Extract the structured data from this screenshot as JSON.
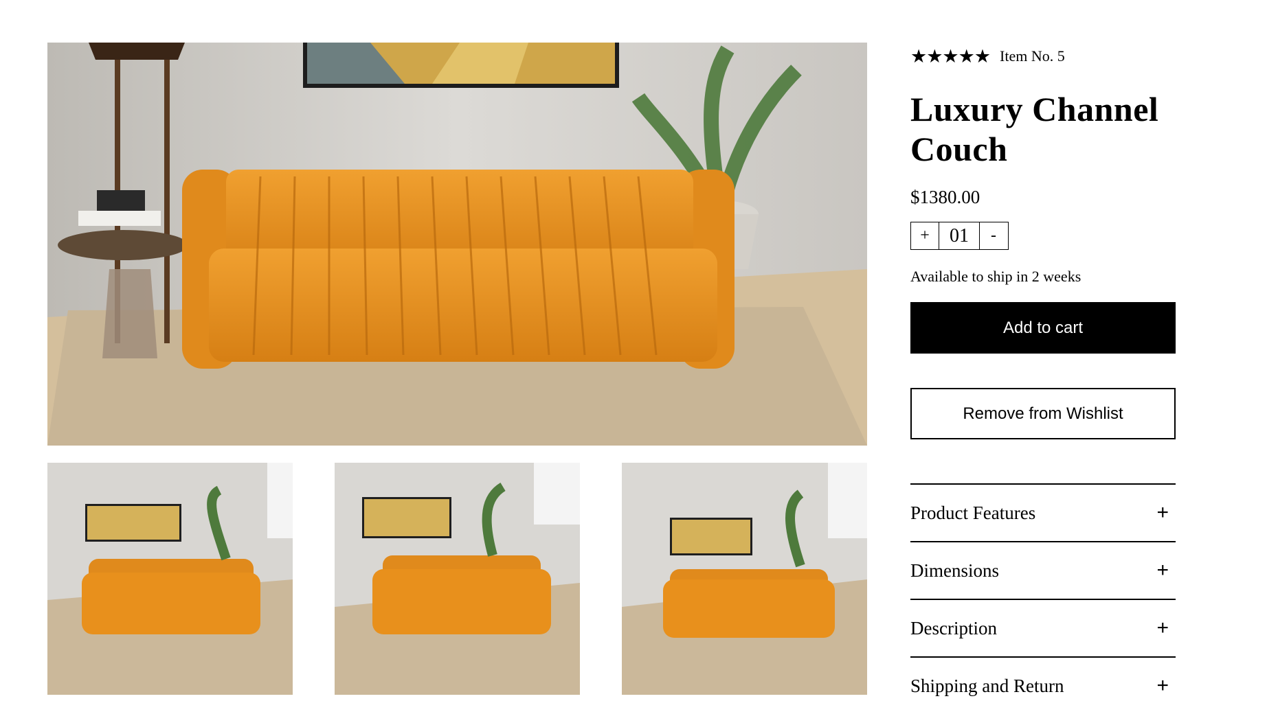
{
  "product": {
    "rating_stars": "★★★★★",
    "item_number": "Item No. 5",
    "title_line1": "Luxury Channel",
    "title_line2": "Couch",
    "price": "$1380.00",
    "quantity": {
      "increment": "+",
      "value": "01",
      "decrement": "-"
    },
    "availability": "Available to ship in 2 weeks",
    "add_to_cart": "Add to cart",
    "remove_wishlist": "Remove from Wishlist"
  },
  "accordion": [
    {
      "label": "Product Features",
      "icon": "+"
    },
    {
      "label": "Dimensions",
      "icon": "+"
    },
    {
      "label": "Description",
      "icon": "+"
    },
    {
      "label": "Shipping and Return",
      "icon": "+"
    }
  ],
  "colors": {
    "sofa": "#e8901c",
    "wall": "#d9d7d3",
    "floor": "#d8c4a4",
    "rug": "#cbb99c"
  }
}
